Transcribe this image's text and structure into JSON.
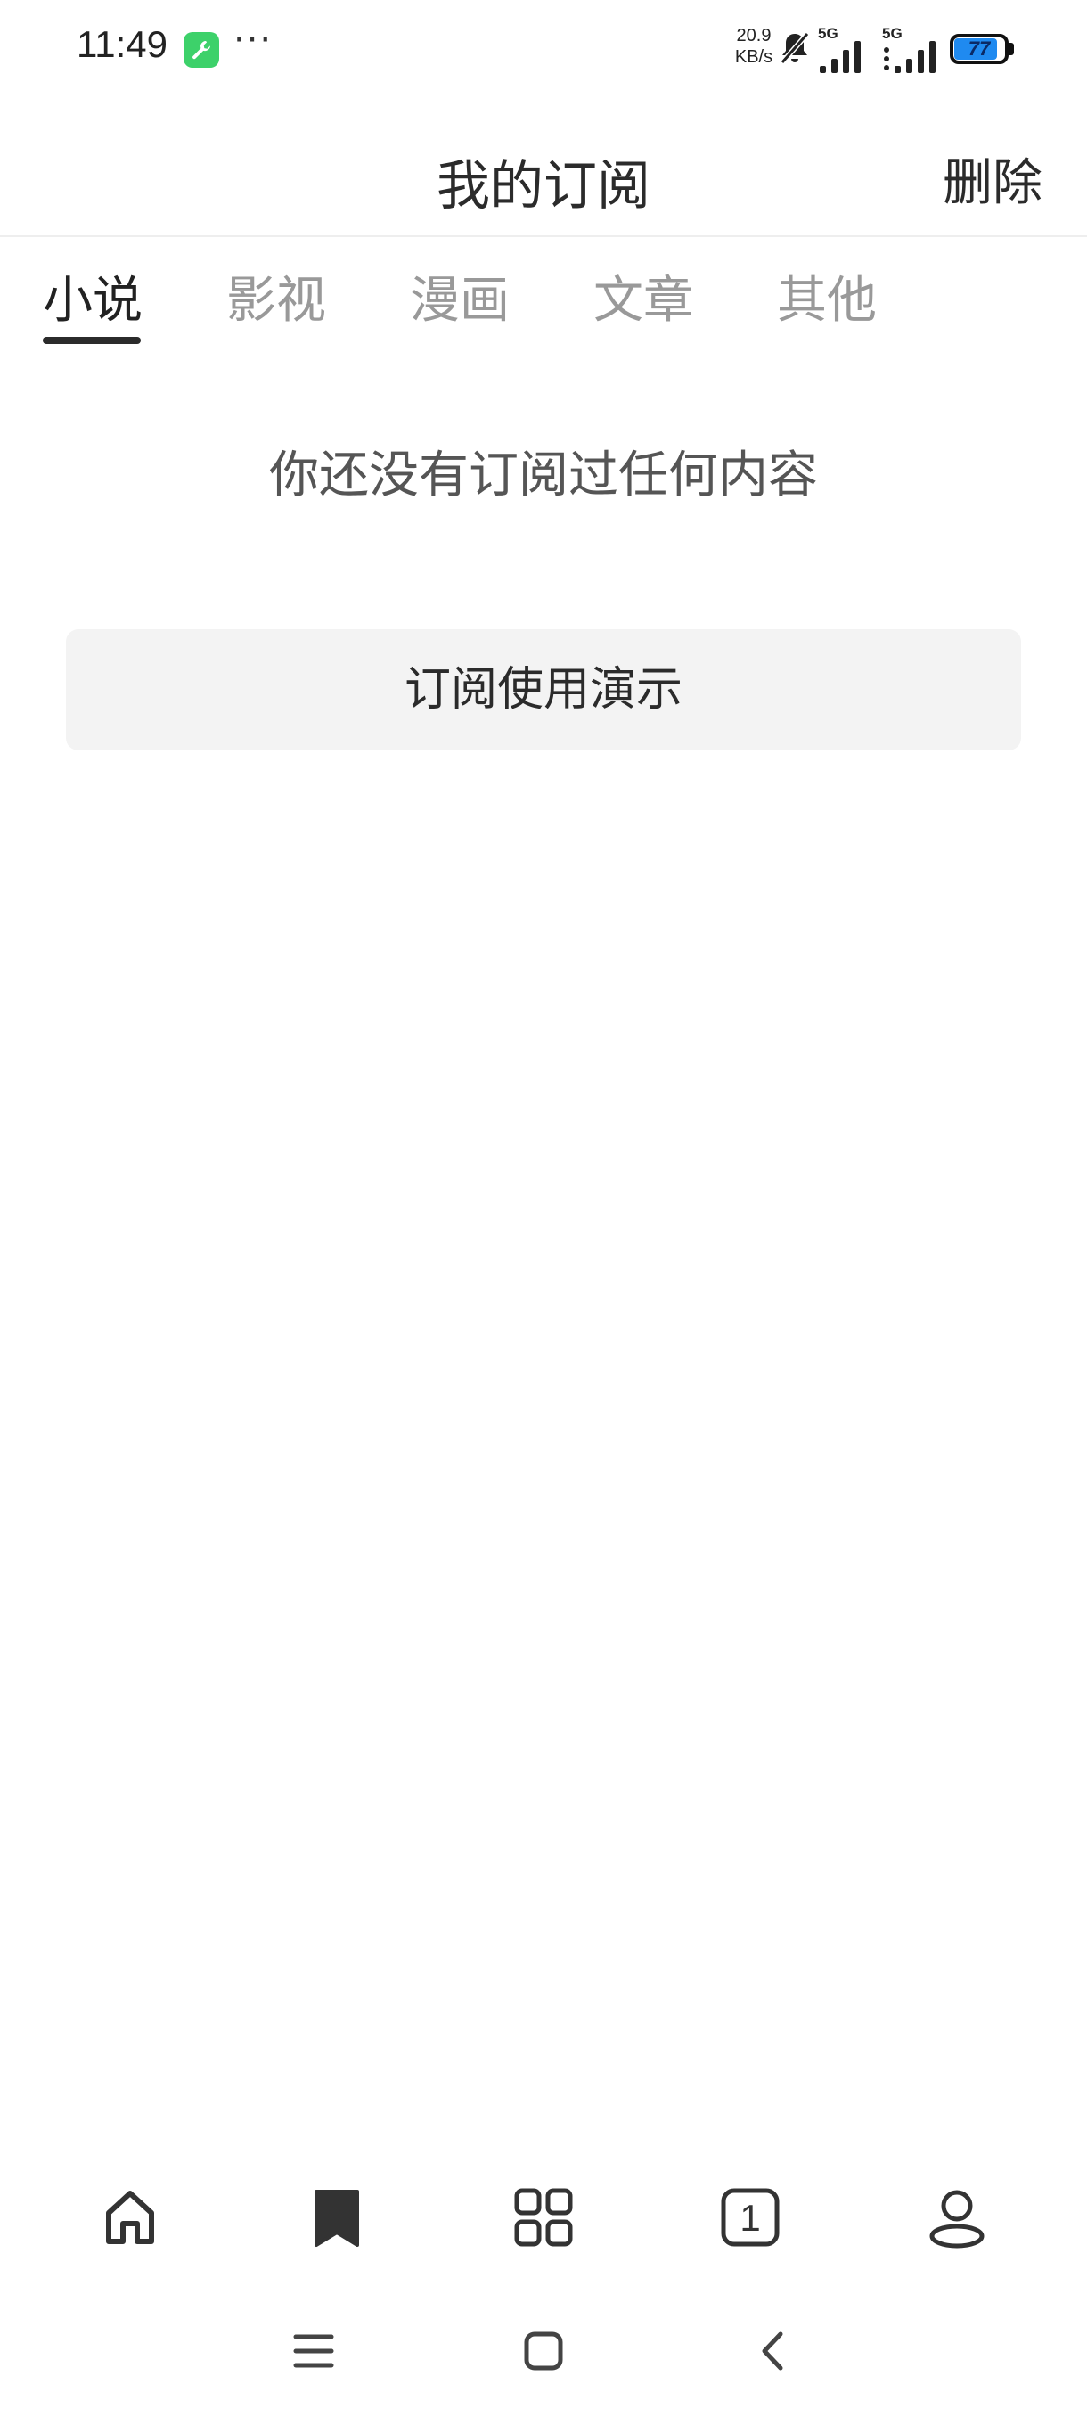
{
  "status_bar": {
    "time": "11:49",
    "more": "···",
    "net_speed_value": "20.9",
    "net_speed_unit": "KB/s",
    "signal_1_label": "5G",
    "signal_2_label": "5G",
    "battery_level": "77",
    "app_icon": "wrench-icon",
    "accent_color": "#3dd16a"
  },
  "header": {
    "title": "我的订阅",
    "delete_label": "删除"
  },
  "tabs": [
    {
      "label": "小说",
      "active": true
    },
    {
      "label": "影视",
      "active": false
    },
    {
      "label": "漫画",
      "active": false
    },
    {
      "label": "文章",
      "active": false
    },
    {
      "label": "其他",
      "active": false
    }
  ],
  "empty_state": {
    "message": "你还没有订阅过任何内容",
    "demo_button": "订阅使用演示"
  },
  "bottom_nav": {
    "items": [
      "home-icon",
      "bookmark-icon",
      "apps-grid-icon",
      "tabs-count-icon",
      "profile-icon"
    ],
    "tab_count": "1",
    "active": "bookmark-icon"
  },
  "system_nav": [
    "menu-icon",
    "home-square-icon",
    "back-icon"
  ]
}
